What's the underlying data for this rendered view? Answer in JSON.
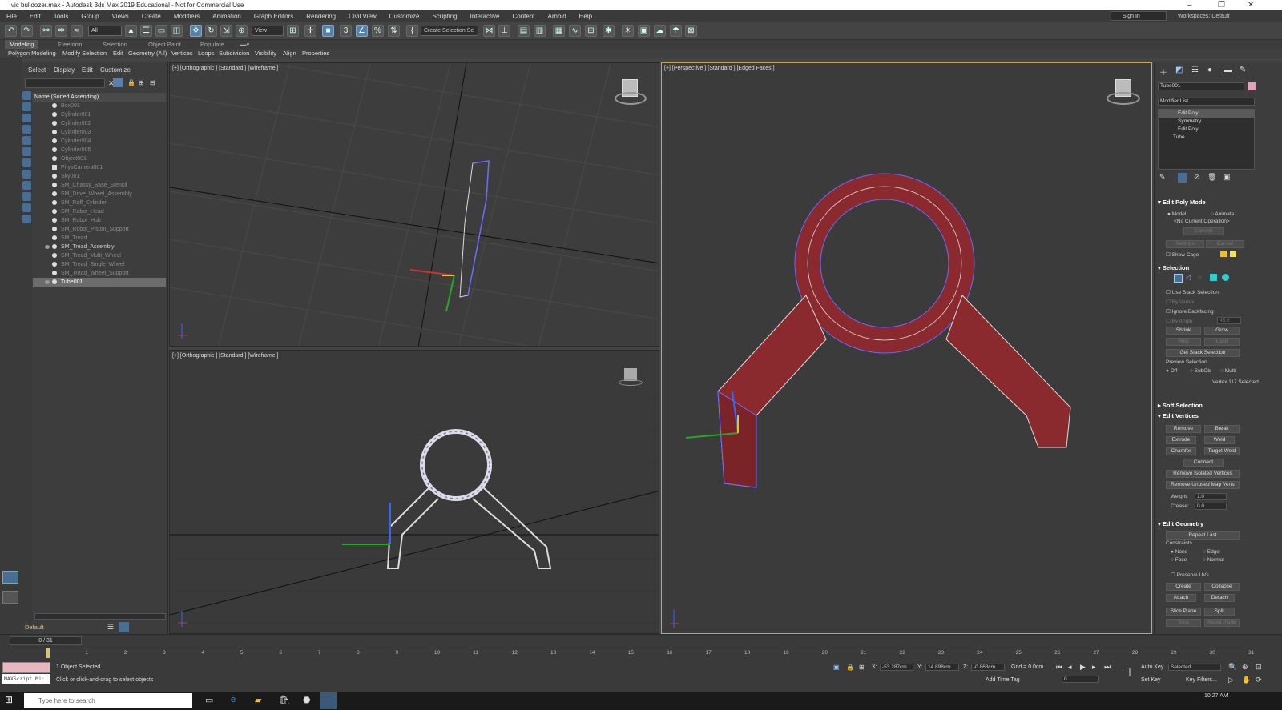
{
  "window": {
    "title": "vic bulldozer.max - Autodesk 3ds Max 2019 Educational - Not for Commercial Use"
  },
  "menu": [
    "File",
    "Edit",
    "Tools",
    "Group",
    "Views",
    "Create",
    "Modifiers",
    "Animation",
    "Graph Editors",
    "Rendering",
    "Civil View",
    "Customize",
    "Scripting",
    "Interactive",
    "Content",
    "Arnold",
    "Help"
  ],
  "signin": "Sign In",
  "workspaces": "Workspaces: Default",
  "toolbar": {
    "filter": "All",
    "view": "View",
    "selection_set": "Create Selection Se"
  },
  "ribbon_tabs": [
    "Modeling",
    "Freeform",
    "Selection",
    "Object Paint",
    "Populate"
  ],
  "ribbon_groups": [
    "Polygon Modeling",
    "Modify Selection",
    "Edit",
    "Geometry (All)",
    "Vertices",
    "Loops",
    "Subdivision",
    "Visibility",
    "Align",
    "Properties"
  ],
  "explorer": {
    "tabs": [
      "Select",
      "Display",
      "Edit",
      "Customize"
    ],
    "header": "Name (Sorted Ascending)",
    "items": [
      "Box001",
      "Cylinder001",
      "Cylinder002",
      "Cylinder003",
      "Cylinder004",
      "Cylinder005",
      "Object001",
      "PhysCamera001",
      "Sky001",
      "SM_Chassy_Base_Stencil",
      "SM_Drive_Wheel_Assembly",
      "SM_Raff_Cylinder",
      "SM_Robot_Head",
      "SM_Robot_Hub",
      "SM_Robot_Piston_Support",
      "SM_Tread",
      "SM_Tread_Assembly",
      "SM_Tread_Multi_Wheel",
      "SM_Tread_Single_Wheel",
      "SM_Tread_Wheel_Support",
      "Tube001"
    ],
    "layer": "Default"
  },
  "viewports": {
    "top_left": "[+] [Orthographic ] [Standard ] [Wireframe ]",
    "bottom_left": "[+] [Orthographic ] [Standard ] [Wireframe ]",
    "right": "[+] [Perspective ] [Standard ] [Edged Faces ]"
  },
  "cmd": {
    "object_name": "Tube001",
    "modifier_list": "Modifier List",
    "stack": [
      "Edit Poly",
      "Symmetry",
      "Edit Poly",
      "Tube"
    ],
    "edit_poly_mode": "Edit Poly Mode",
    "model": "Model",
    "animate": "Animate",
    "no_op": "<No Current Operation>",
    "commit": "Commit",
    "settings": "Settings",
    "cancel": "Cancel",
    "show_cage": "Show Cage",
    "selection": "Selection",
    "use_stack": "Use Stack Selection",
    "by_vertex": "By Vertex",
    "ignore_backfacing": "Ignore Backfacing",
    "by_angle": "By Angle:",
    "angle_value": "45.0",
    "shrink": "Shrink",
    "grow": "Grow",
    "ring": "Ring",
    "loop": "Loop",
    "get_stack": "Get Stack Selection",
    "preview": "Preview Selection",
    "off": "Off",
    "subobj": "SubObj",
    "multi": "Multi",
    "vertex_count": "Vertex 117 Selected",
    "soft_selection": "Soft Selection",
    "edit_vertices": "Edit Vertices",
    "remove": "Remove",
    "break": "Break",
    "extrude": "Extrude",
    "weld": "Weld",
    "chamfer": "Chamfer",
    "target_weld": "Target Weld",
    "connect": "Connect",
    "remove_isolated": "Remove Isolated Vertices",
    "remove_unused": "Remove Unused Map Verts",
    "weight_label": "Weight:",
    "weight": "1.0",
    "crease_label": "Crease:",
    "crease": "0.0",
    "edit_geometry": "Edit Geometry",
    "repeat_last": "Repeat Last",
    "constraints": "Constraints",
    "none": "None",
    "edge": "Edge",
    "face": "Face",
    "normal": "Normal",
    "preserve_uvs": "Preserve UVs",
    "create": "Create",
    "collapse": "Collapse",
    "attach": "Attach",
    "detach": "Detach",
    "slice_plane": "Slice Plane",
    "split": "Split",
    "slice": "Slice",
    "reset_plane": "Reset Plane"
  },
  "timeline": {
    "frame": "0 / 31",
    "ticks": [
      "0",
      "1",
      "2",
      "3",
      "4",
      "5",
      "6",
      "7",
      "8",
      "9",
      "10",
      "11",
      "12",
      "13",
      "14",
      "15",
      "16",
      "17",
      "18",
      "19",
      "20",
      "21",
      "22",
      "23",
      "24",
      "25",
      "26",
      "27",
      "28",
      "29",
      "30",
      "31"
    ]
  },
  "status": {
    "maxscript": "MAXScript Mi:",
    "selected": "1 Object Selected",
    "prompt": "Click or click-and-drag to select objects",
    "x": "-53.287cm",
    "y": "14.898cm",
    "z": "-0.863cm",
    "grid": "Grid = 0.0cm",
    "add_time_tag": "Add Time Tag",
    "auto_key": "Auto Key",
    "set_key": "Set Key",
    "selected_dd": "Selected",
    "key_filters": "Key Filters...",
    "frame_field": "0"
  },
  "taskbar": {
    "search": "Type here to search",
    "clock": "10:27 AM"
  }
}
